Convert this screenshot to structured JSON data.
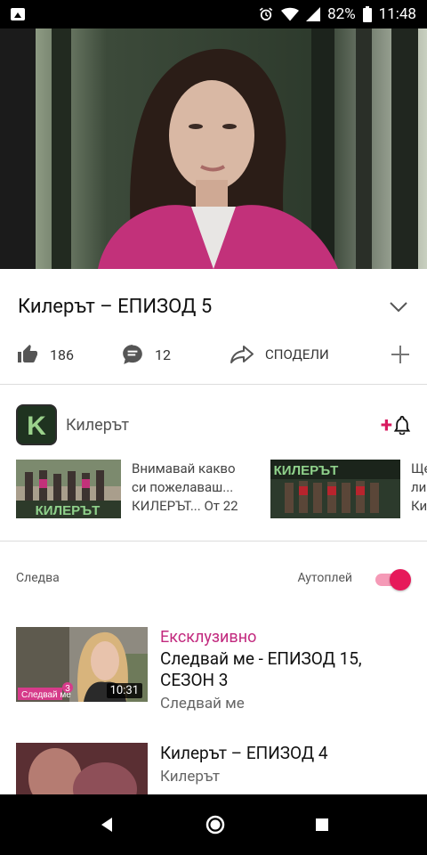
{
  "status_bar": {
    "battery": "82%",
    "time": "11:48",
    "icons": [
      "image-icon",
      "alarm-icon",
      "wifi-icon",
      "signal-icon",
      "battery-icon"
    ]
  },
  "video": {
    "title": "Килерът – ЕПИЗОД 5",
    "likes": "186",
    "comments": "12",
    "share_label": "СПОДЕЛИ"
  },
  "channel": {
    "name": "Килерът",
    "logo_letter": "K"
  },
  "related": [
    {
      "line1": "Внимавай какво",
      "line2": "си пожелаваш...",
      "line3": "КИЛЕРЪТ... От 22",
      "thumb_text": "КИЛЕРЪТ"
    },
    {
      "line1": "Ще",
      "line2": "ли д",
      "line3": "Кил",
      "thumb_text": "КИЛЕРЪТ"
    }
  ],
  "up_next": {
    "label": "Следва",
    "autoplay_label": "Аутоплей",
    "items": [
      {
        "badge": "Ексклузивно",
        "title_line1": "Следвай ме - ЕПИЗОД 15,",
        "title_line2": "СЕЗОН 3",
        "channel": "Следвай ме",
        "duration": "10:31",
        "thumb_logo": "Следвай ме",
        "thumb_num": "3"
      },
      {
        "badge": "",
        "title_line1": "Килерът – ЕПИЗОД 4",
        "title_line2": "",
        "channel": "Килерът",
        "duration": ""
      }
    ]
  },
  "colors": {
    "accent": "#e6195a",
    "badge": "#c2297e"
  }
}
